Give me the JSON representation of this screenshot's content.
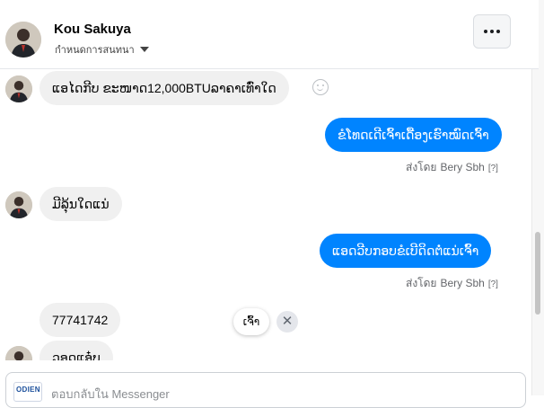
{
  "header": {
    "contact_name": "Kou Sakuya",
    "subtitle": "กำหนดการสนทนา",
    "subtitle_icon": "caret-down-icon",
    "more_icon": "more-dots-icon"
  },
  "messages": [
    {
      "direction": "incoming",
      "text": "ແອໄດກີບ ຂະໜາດ12,000BTUລາຄາເທົ່າໃດ",
      "reaction_icon": "smiley-icon"
    },
    {
      "direction": "outgoing",
      "text": "ຂໍໂທດເດີເຈົ້າເດື້ອງເຮົາໝົດເຈົ້າ",
      "sent_by_label": "ส่งโดย",
      "sender": "Bery Sbh",
      "help": "[?]"
    },
    {
      "direction": "incoming",
      "text": "ມີລຸ້ນໃດແນ່"
    },
    {
      "direction": "outgoing",
      "text": "ແອດວີບກອບຂໍເບີດິດຕໍ່ແນ່ເຈົ້າ",
      "sent_by_label": "ส่งโดย",
      "sender": "Bery Sbh",
      "help": "[?]"
    },
    {
      "direction": "incoming",
      "text": "77741742"
    },
    {
      "direction": "incoming",
      "text": "ວອດແອ໋ບ"
    }
  ],
  "quick_reply": {
    "label": "ເຈົ້າ",
    "close": "✕"
  },
  "composer": {
    "placeholder": "ตอบกลับใน Messenger",
    "logo_text": "ODIEN"
  },
  "colors": {
    "outgoing_bubble": "#0084ff",
    "incoming_bubble": "#f0f0f0",
    "meta_text": "#65676b"
  }
}
